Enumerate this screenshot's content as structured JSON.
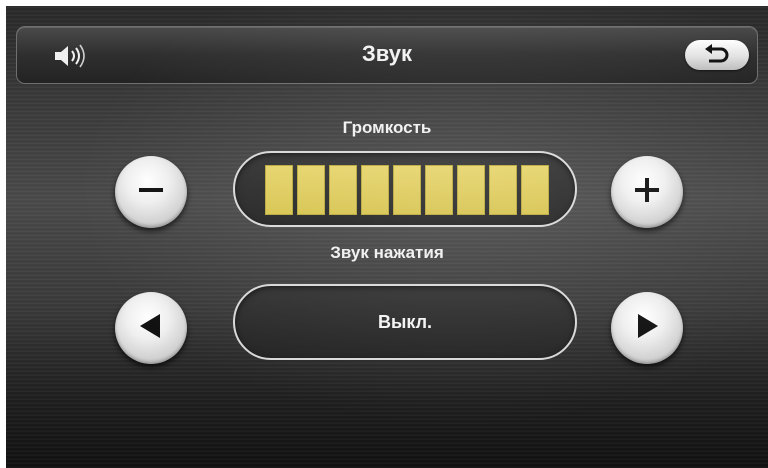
{
  "header": {
    "title": "Звук",
    "speaker_icon": "speaker-volume-icon",
    "back_icon": "back-arrow-icon"
  },
  "volume": {
    "label": "Громкость",
    "level": 9,
    "max": 9,
    "bar_color": "#d7c44f",
    "decrease_icon": "minus-icon",
    "increase_icon": "plus-icon"
  },
  "click_sound": {
    "label": "Звук нажатия",
    "value": "Выкл.",
    "prev_icon": "left-triangle-icon",
    "next_icon": "right-triangle-icon"
  }
}
